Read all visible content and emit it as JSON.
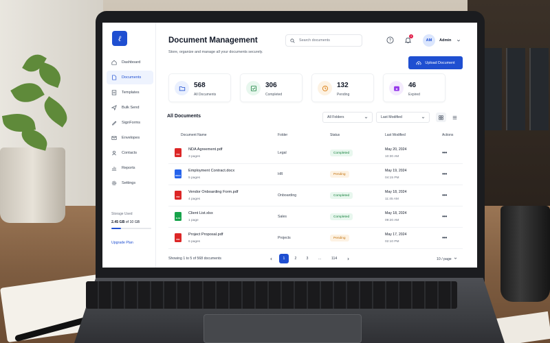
{
  "app": {
    "title": "Document Management",
    "subtitle": "Store, organize and manage all your documents securely."
  },
  "colors": {
    "accent": "#1f4fd1",
    "completed": "#16803c",
    "pending": "#c2700a",
    "expired": "#9333ea"
  },
  "sidebar": {
    "items": [
      {
        "label": "Dashboard",
        "icon": "home-icon",
        "active": false
      },
      {
        "label": "Documents",
        "icon": "document-icon",
        "active": true
      },
      {
        "label": "Templates",
        "icon": "template-icon",
        "active": false
      },
      {
        "label": "Bulk Send",
        "icon": "send-icon",
        "active": false
      },
      {
        "label": "SignForms",
        "icon": "pen-icon",
        "active": false
      },
      {
        "label": "Envelopes",
        "icon": "envelope-icon",
        "active": false
      },
      {
        "label": "Contacts",
        "icon": "contacts-icon",
        "active": false
      },
      {
        "label": "Reports",
        "icon": "chart-icon",
        "active": false
      },
      {
        "label": "Settings",
        "icon": "gear-icon",
        "active": false
      }
    ],
    "storage": {
      "label": "Storage Used",
      "used": "2.45 GB",
      "of_text": "of 10 GB",
      "fraction": 0.245
    },
    "upgrade_label": "Upgrade Plan"
  },
  "header": {
    "search_placeholder": "Search documents",
    "notifications_count": "3",
    "avatar_initials": "AM",
    "user_name": "Admin",
    "upload_label": "Upload Document"
  },
  "stats": [
    {
      "value": "568",
      "label": "All Documents",
      "icon": "folder-icon"
    },
    {
      "value": "306",
      "label": "Completed",
      "icon": "check-icon"
    },
    {
      "value": "132",
      "label": "Pending",
      "icon": "clock-icon"
    },
    {
      "value": "46",
      "label": "Expired",
      "icon": "calendar-x-icon"
    }
  ],
  "documents": {
    "section_title": "All Documents",
    "folder_filter": "All Folders",
    "sort": "Last Modified",
    "columns": [
      "Document Name",
      "Folder",
      "Status",
      "Last Modified",
      "Actions"
    ],
    "rows": [
      {
        "name": "NDA Agreement.pdf",
        "pages": "3 pages",
        "type": "PDF",
        "folder": "Legal",
        "status": "Completed",
        "date": "May 20, 2024",
        "time": "10:30 AM"
      },
      {
        "name": "Employment Contract.docx",
        "pages": "5 pages",
        "type": "DOCX",
        "folder": "HR",
        "status": "Pending",
        "date": "May 19, 2024",
        "time": "04:15 PM"
      },
      {
        "name": "Vendor Onboarding Form.pdf",
        "pages": "4 pages",
        "type": "PDF",
        "folder": "Onboarding",
        "status": "Completed",
        "date": "May 18, 2024",
        "time": "11:45 AM"
      },
      {
        "name": "Client List.xlsx",
        "pages": "1 page",
        "type": "XLSX",
        "folder": "Sales",
        "status": "Completed",
        "date": "May 18, 2024",
        "time": "09:20 AM"
      },
      {
        "name": "Project Proposal.pdf",
        "pages": "6 pages",
        "type": "PDF",
        "folder": "Projects",
        "status": "Pending",
        "date": "May 17, 2024",
        "time": "02:10 PM"
      }
    ],
    "showing_text": "Showing 1 to 5 of 568 documents",
    "pages": [
      "1",
      "2",
      "3",
      "...",
      "114"
    ],
    "current_page": "1",
    "per_page": "10 / page"
  }
}
